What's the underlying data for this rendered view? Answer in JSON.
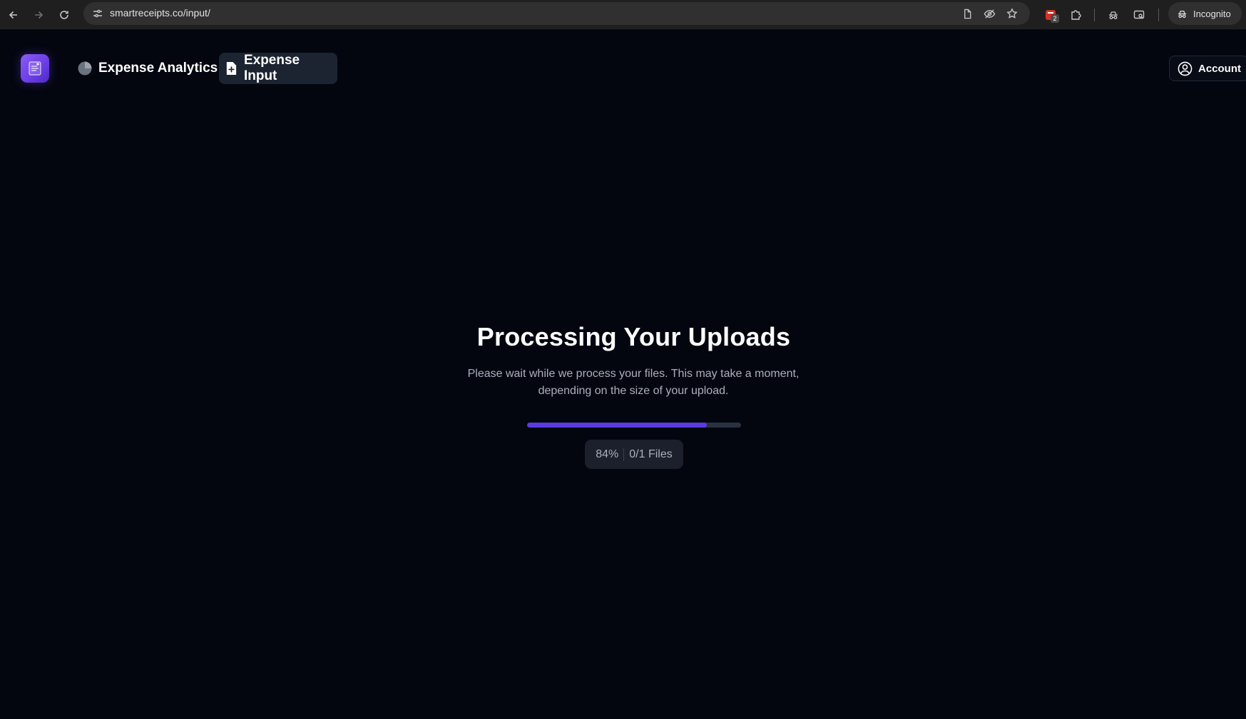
{
  "browser": {
    "url": "smartreceipts.co/input/",
    "incognito_label": "Incognito",
    "extension_badge": "2"
  },
  "header": {
    "nav": [
      {
        "label": "Expense Analytics",
        "icon": "pie-chart-icon",
        "active": false
      },
      {
        "label": "Expense Input",
        "icon": "file-plus-icon",
        "active": true
      }
    ],
    "account_label": "Account"
  },
  "main": {
    "title": "Processing Your Uploads",
    "description": "Please wait while we process your files. This may take a moment, depending on the size of your upload.",
    "progress_percent": 84,
    "progress_label": "84%",
    "files_label": "0/1 Files"
  },
  "colors": {
    "background": "#03060f",
    "accent": "#5b3ae0",
    "logo_gradient_start": "#8a5cf6",
    "logo_gradient_end": "#4c2bc4"
  }
}
